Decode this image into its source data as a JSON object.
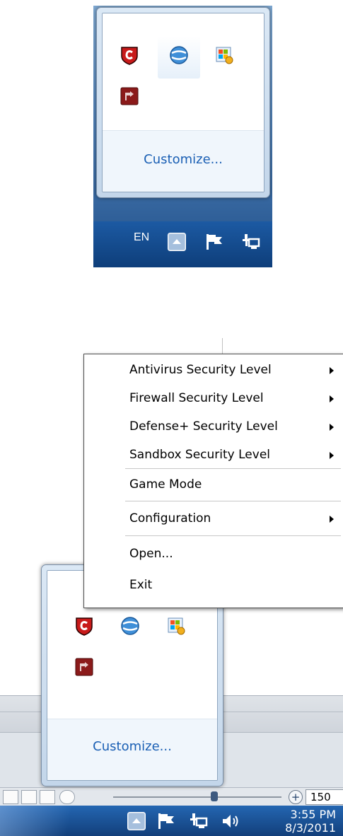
{
  "top_panel": {
    "tray_icons": [
      "comodo-shield-icon",
      "globe-app-icon",
      "windows-update-icon",
      "red-app-icon"
    ],
    "customize_label": "Customize...",
    "language_label": "EN",
    "taskbar_icons": [
      "show-hidden-icons-button",
      "action-center-flag-icon",
      "network-icon"
    ]
  },
  "bottom_panel": {
    "context_menu": {
      "items": [
        {
          "label": "Antivirus Security Level",
          "submenu": true
        },
        {
          "label": "Firewall Security Level",
          "submenu": true
        },
        {
          "label": "Defense+ Security Level",
          "submenu": true
        },
        {
          "label": "Sandbox Security Level",
          "submenu": true
        },
        {
          "label": "Game Mode",
          "submenu": false
        },
        {
          "label": "Configuration",
          "submenu": true
        },
        {
          "label": "Open...",
          "submenu": false
        },
        {
          "label": "Exit",
          "submenu": false
        }
      ]
    },
    "customize_label": "Customize...",
    "zoom_value": "150",
    "clock": {
      "time": "3:55 PM",
      "date": "8/3/2011"
    },
    "taskbar_icons": [
      "show-hidden-icons-button",
      "action-center-flag-icon",
      "network-icon",
      "volume-icon"
    ]
  }
}
